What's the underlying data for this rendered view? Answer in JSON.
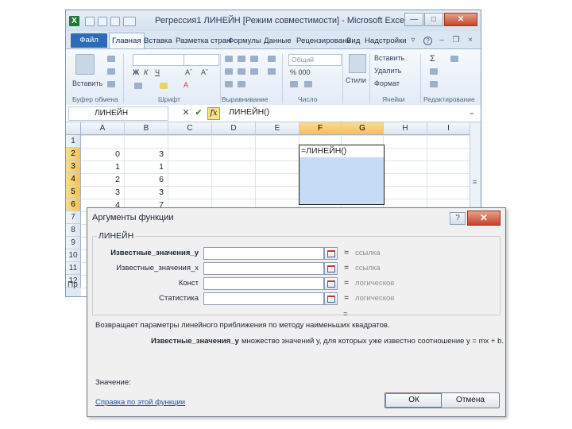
{
  "window": {
    "logo": "X",
    "title": "Регрессия1 ЛИНЕЙН [Режим совместимости] - Microsoft Excel ...",
    "minimize": "—",
    "maximize": "□",
    "close": "✕"
  },
  "ribbon": {
    "tabs": [
      "Файл",
      "Главная",
      "Вставка",
      "Разметка стран",
      "Формулы",
      "Данные",
      "Рецензировани",
      "Вид",
      "Надстройки"
    ],
    "groups": [
      "Буфер обмена",
      "Шрифт",
      "Выравнивание",
      "Число",
      "Ячейки",
      "Редактирование"
    ],
    "paste_label": "Вставить",
    "styles_label": "Стили",
    "number_format": "Общий",
    "cells_buttons": [
      "Вставить",
      "Удалить",
      "Формат"
    ],
    "number_symbols": "% 000"
  },
  "formula_bar": {
    "name_box": "ЛИНЕЙН",
    "cancel": "✕",
    "enter": "✔",
    "fx": "fx",
    "formula": "ЛИНЕЙН()"
  },
  "sheet": {
    "columns": [
      "A",
      "B",
      "C",
      "D",
      "E",
      "F",
      "G",
      "H",
      "I"
    ],
    "rows": [
      "1",
      "2",
      "3",
      "4",
      "5",
      "6",
      "7",
      "8",
      "9",
      "10",
      "11",
      "12",
      "13"
    ],
    "col_a": [
      "0",
      "1",
      "2",
      "3",
      "4"
    ],
    "col_b": [
      "3",
      "1",
      "6",
      "3",
      "7"
    ],
    "active_cell_text": "=ЛИНЕЙН()",
    "statusbar_prefix": "Пр"
  },
  "dialog": {
    "title": "Аргументы функции",
    "help": "?",
    "close": "✕",
    "function_name": "ЛИНЕЙН",
    "args": [
      {
        "name": "Известные_значения_у",
        "type": "ссылка"
      },
      {
        "name": "Известные_значения_х",
        "type": "ссылка"
      },
      {
        "name": "Конст",
        "type": "логическое"
      },
      {
        "name": "Статистика",
        "type": "логическое"
      }
    ],
    "eq": "=",
    "result_eq": "=",
    "description": "Возвращает параметры линейного приближения по методу наименьших квадратов.",
    "arg_help_name": "Известные_значения_у",
    "arg_help_text": "множество значений у, для которых уже известно соотношение у = mx + b.",
    "value_label": "Значение:",
    "help_link": "Справка по этой функции",
    "ok": "ОК",
    "cancel": "Отмена"
  }
}
